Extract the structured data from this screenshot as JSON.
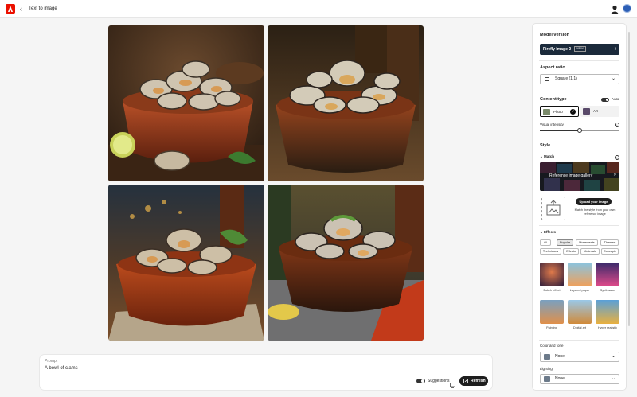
{
  "header": {
    "back_glyph": "‹",
    "title": "Text to image"
  },
  "icons": {
    "logo": "adobe-logo-icon",
    "back": "chevron-left-icon",
    "user": "user-icon",
    "cloud": "creative-cloud-icon"
  },
  "gallery": {
    "images": [
      {
        "alt": "clams in terracotta bowl with lime"
      },
      {
        "alt": "clams in dark bowl"
      },
      {
        "alt": "clams in bowl with basil"
      },
      {
        "alt": "clams in patterned bowl with lemon"
      }
    ]
  },
  "prompt": {
    "label": "Prompt",
    "value": "A bowl of clams",
    "suggestions_label": "Suggestions",
    "refresh_label": "Refresh"
  },
  "panel": {
    "model_version": {
      "title": "Model version",
      "value": "Firefly Image 2",
      "badge": "NEW"
    },
    "aspect_ratio": {
      "title": "Aspect ratio",
      "value": "Square (1:1)"
    },
    "content_type": {
      "title": "Content type",
      "auto_label": "Auto",
      "options": [
        {
          "label": "Photo",
          "selected": true
        },
        {
          "label": "Art",
          "selected": false
        }
      ]
    },
    "visual_intensity": {
      "label": "Visual intensity",
      "level": 0.5
    },
    "style": {
      "title": "Style",
      "match_label": "Match",
      "gallery_label": "Reference image gallery",
      "upload_button": "Upload your image",
      "upload_desc": "Match the style from your own reference image"
    },
    "effects": {
      "title": "Effects",
      "tabs_row1": [
        "All",
        "Popular",
        "Movements",
        "Themes"
      ],
      "tabs_row2": [
        "Techniques",
        "Effects",
        "Materials",
        "Concepts"
      ],
      "active_tab": "Popular",
      "tiles": [
        {
          "label": "Bokeh effect"
        },
        {
          "label": "Layered paper"
        },
        {
          "label": "Synthwave"
        },
        {
          "label": "Painting"
        },
        {
          "label": "Digital art"
        },
        {
          "label": "Hyper realistic"
        }
      ]
    },
    "color_tone": {
      "label": "Color and tone",
      "value": "None"
    },
    "lighting": {
      "label": "Lighting",
      "value": "None"
    }
  },
  "colors": {
    "accent": "#eb1000",
    "button_dark": "#1e1e1e",
    "model_bg": "#1b2a3b"
  }
}
